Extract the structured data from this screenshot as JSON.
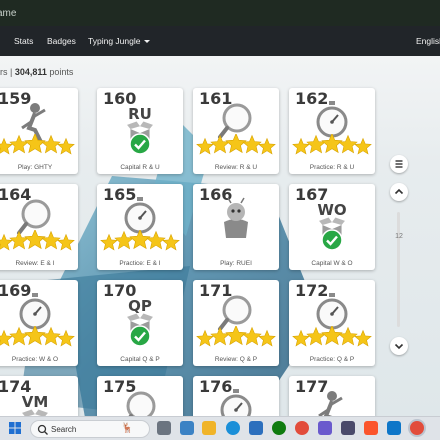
{
  "window": {
    "title_fragment": "ame"
  },
  "nav": {
    "items": [
      {
        "label": "Stats"
      },
      {
        "label": "Badges"
      },
      {
        "label": "Typing Jungle"
      }
    ],
    "language": "English"
  },
  "summary": {
    "prefix": "rs",
    "points": "304,811",
    "points_label": "points"
  },
  "lessons": [
    {
      "number": "159",
      "caption": "Play: GHTY",
      "icon": "trophy-figure-icon",
      "stars": 5
    },
    {
      "number": "160",
      "code": "RU",
      "caption": "Capital R & U",
      "icon": "open-box-icon",
      "completed": true
    },
    {
      "number": "161",
      "caption": "Review: R & U",
      "icon": "magnifier-icon",
      "stars": 5
    },
    {
      "number": "162",
      "caption": "Practice: R & U",
      "icon": "stopwatch-icon",
      "stars": 5
    },
    {
      "number": "164",
      "caption": "Review: E & I",
      "icon": "magnifier-icon",
      "stars": 5
    },
    {
      "number": "165",
      "caption": "Practice: E & I",
      "icon": "stopwatch-icon",
      "stars": 5
    },
    {
      "number": "166",
      "caption": "Play: RUEI",
      "icon": "creature-icon"
    },
    {
      "number": "167",
      "code": "WO",
      "caption": "Capital W & O",
      "icon": "open-box-icon",
      "completed": true
    },
    {
      "number": "169",
      "caption": "Practice: W & O",
      "icon": "stopwatch-icon",
      "stars": 5
    },
    {
      "number": "170",
      "code": "QP",
      "caption": "Capital Q & P",
      "icon": "open-box-icon",
      "completed": true
    },
    {
      "number": "171",
      "caption": "Review: Q & P",
      "icon": "magnifier-icon",
      "stars": 5
    },
    {
      "number": "172",
      "caption": "Practice: Q & P",
      "icon": "stopwatch-icon",
      "stars": 5
    },
    {
      "number": "174",
      "code": "VM",
      "icon": "open-box-icon"
    },
    {
      "number": "175",
      "icon": "magnifier-icon"
    },
    {
      "number": "176",
      "icon": "stopwatch-icon"
    },
    {
      "number": "177",
      "icon": "trophy-figure-icon"
    }
  ],
  "side_controls": {
    "page_number": "12"
  },
  "taskbar": {
    "search_placeholder": "Search"
  },
  "colors": {
    "star": "#f5c518",
    "check": "#28a745",
    "nav_bg": "#212529",
    "card_bg": "#ffffff"
  }
}
